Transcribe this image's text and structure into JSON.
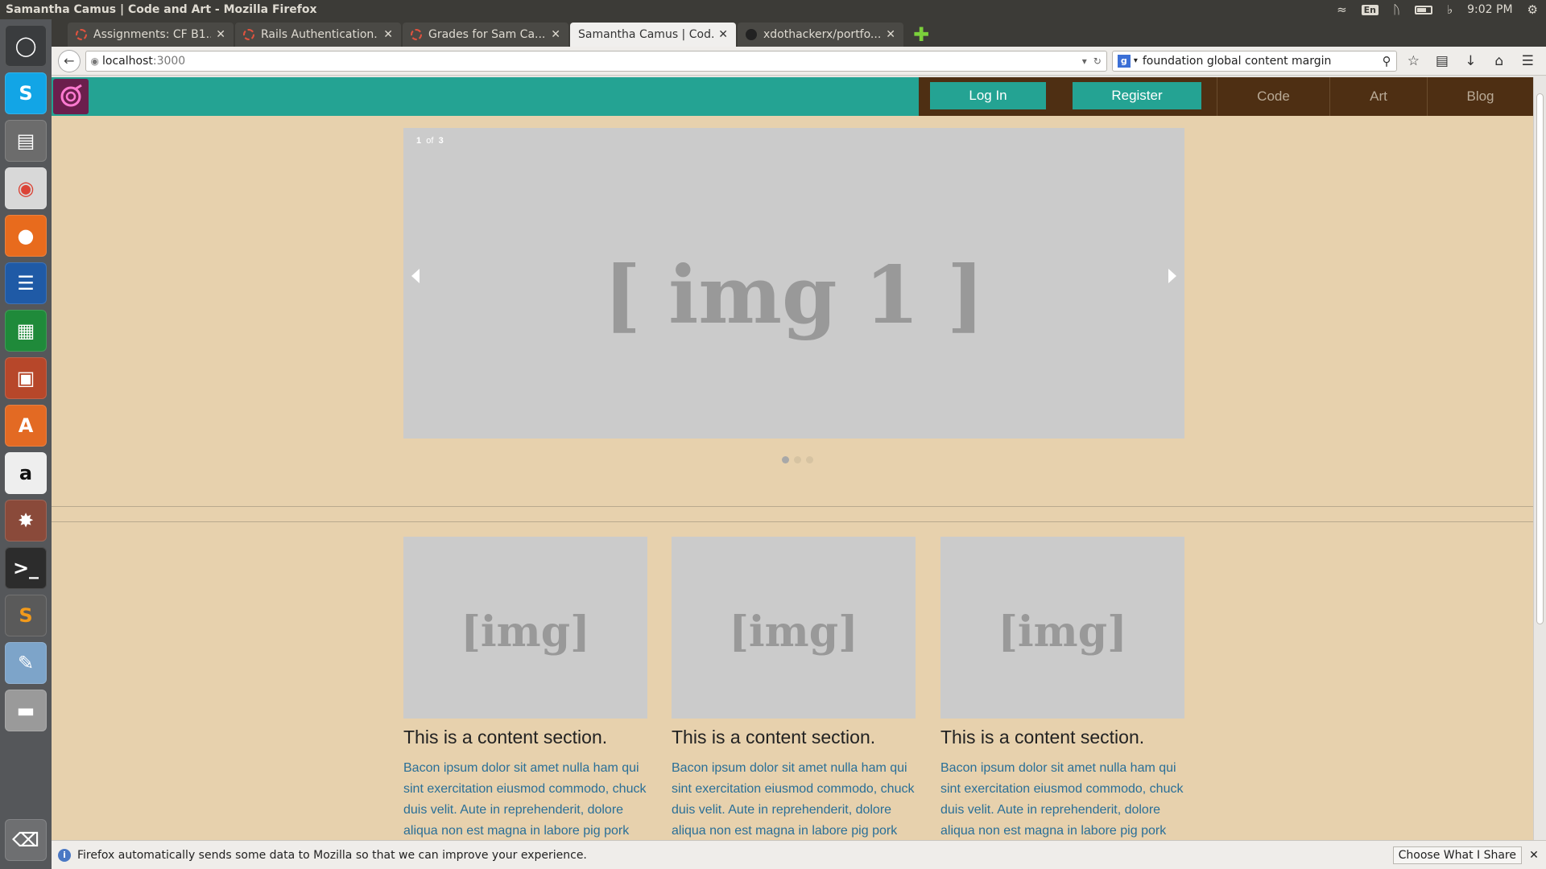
{
  "window": {
    "title": "Samantha Camus | Code and Art - Mozilla Firefox"
  },
  "tray": {
    "lang": "En",
    "time": "9:02 PM"
  },
  "tabs": [
    {
      "label": "Assignments: CF B1...",
      "active": false
    },
    {
      "label": "Rails Authentication...",
      "active": false
    },
    {
      "label": "Grades for Sam Ca...",
      "active": false
    },
    {
      "label": "Samantha Camus | Cod...",
      "active": true
    },
    {
      "label": "xdothackerx/portfo...",
      "active": false
    }
  ],
  "url": {
    "host": "localhost",
    "port": ":3000"
  },
  "search": {
    "value": "foundation global content margin"
  },
  "site": {
    "nav": {
      "login": "Log In",
      "register": "Register",
      "code": "Code",
      "art": "Art",
      "blog": "Blog"
    },
    "slider": {
      "count_current": "1",
      "count_of": "of",
      "count_total": "3",
      "image": "[ img 1 ]"
    },
    "content": [
      {
        "image": "[img]",
        "heading": "This is a content section.",
        "body": "Bacon ipsum dolor sit amet nulla ham qui sint exercitation eiusmod commodo, chuck duis velit. Aute in reprehenderit, dolore aliqua non est magna in labore pig pork"
      },
      {
        "image": "[img]",
        "heading": "This is a content section.",
        "body": "Bacon ipsum dolor sit amet nulla ham qui sint exercitation eiusmod commodo, chuck duis velit. Aute in reprehenderit, dolore aliqua non est magna in labore pig pork"
      },
      {
        "image": "[img]",
        "heading": "This is a content section.",
        "body": "Bacon ipsum dolor sit amet nulla ham qui sint exercitation eiusmod commodo, chuck duis velit. Aute in reprehenderit, dolore aliqua non est magna in labore pig pork"
      }
    ]
  },
  "notice": {
    "text": "Firefox automatically sends some data to Mozilla so that we can improve your experience.",
    "button": "Choose What I Share"
  },
  "colors": {
    "teal": "#24a393",
    "brown": "#4e2f13",
    "page_bg": "#e7d1ad",
    "placeholder": "#cbcbcb",
    "link_text": "#2a6f97"
  },
  "icons": {
    "launcher": [
      "ubuntu-dash-icon",
      "skype-icon",
      "files-icon",
      "chrome-icon",
      "firefox-icon",
      "writer-icon",
      "calc-icon",
      "impress-icon",
      "software-center-icon",
      "amazon-icon",
      "settings-icon",
      "terminal-icon",
      "sublime-icon",
      "drawing-icon",
      "drive-icon",
      "trash-icon"
    ]
  }
}
